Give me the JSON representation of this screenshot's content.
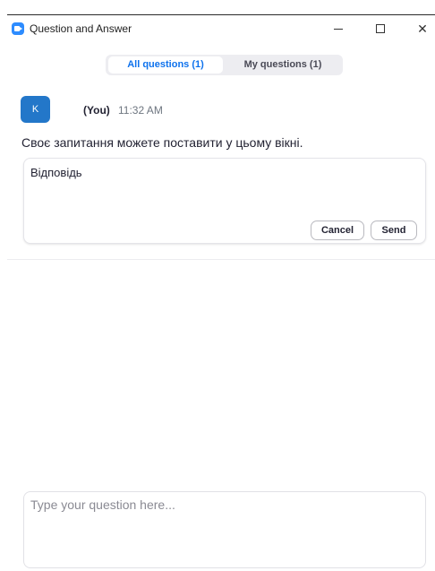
{
  "window": {
    "title": "Question and Answer",
    "minimize_glyph": "",
    "maximize_glyph": "",
    "close_glyph": "✕"
  },
  "tabs": [
    {
      "label": "All questions (1)",
      "selected": true
    },
    {
      "label": "My questions (1)",
      "selected": false
    }
  ],
  "question": {
    "avatar_initial": "K",
    "author": "(You)",
    "time": "11:32 AM",
    "text": "Своє запитання можете поставити у цьому вікні."
  },
  "answer": {
    "text": "Відповідь",
    "cancel_label": "Cancel",
    "send_label": "Send"
  },
  "compose": {
    "placeholder": "Type your question here..."
  },
  "colors": {
    "accent": "#0e72ed",
    "avatar": "#2377c9",
    "app_icon": "#2d8cff"
  }
}
